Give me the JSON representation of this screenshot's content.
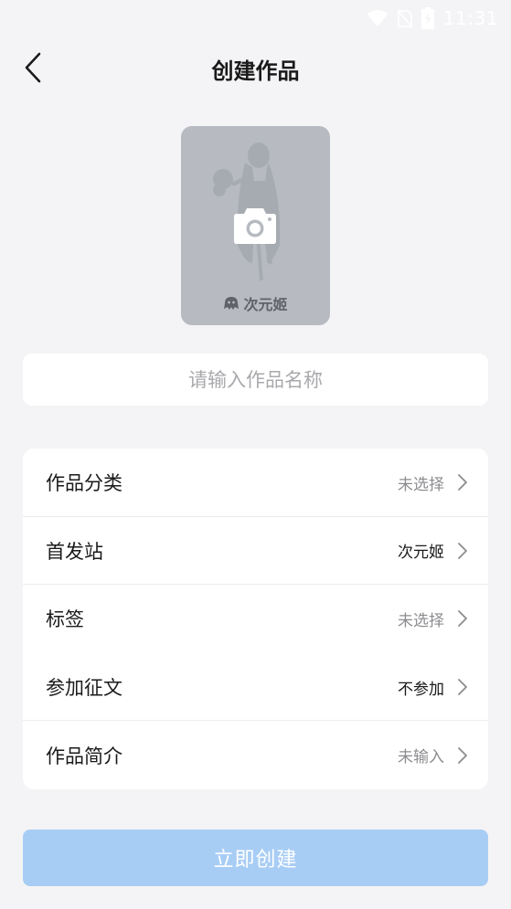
{
  "status_bar": {
    "time": "11:31",
    "icons": [
      "wifi-icon",
      "no-sim-icon",
      "battery-charging-icon"
    ]
  },
  "header": {
    "title": "创建作品",
    "back_icon": "chevron-left-icon"
  },
  "cover": {
    "icon": "camera-icon",
    "logo_text": "次元姬"
  },
  "name_input": {
    "placeholder": "请输入作品名称",
    "value": ""
  },
  "settings": {
    "rows": [
      {
        "label": "作品分类",
        "value": "未选择"
      },
      {
        "label": "首发站",
        "value": "次元姬"
      },
      {
        "label": "标签",
        "value": "未选择"
      },
      {
        "label": "参加征文",
        "value": "不参加"
      },
      {
        "label": "作品简介",
        "value": "未输入"
      }
    ]
  },
  "create_button": {
    "label": "立即创建"
  },
  "colors": {
    "background": "#f4f4f6",
    "button_disabled": "#a8cdf5",
    "muted_text": "#8c8c90"
  }
}
